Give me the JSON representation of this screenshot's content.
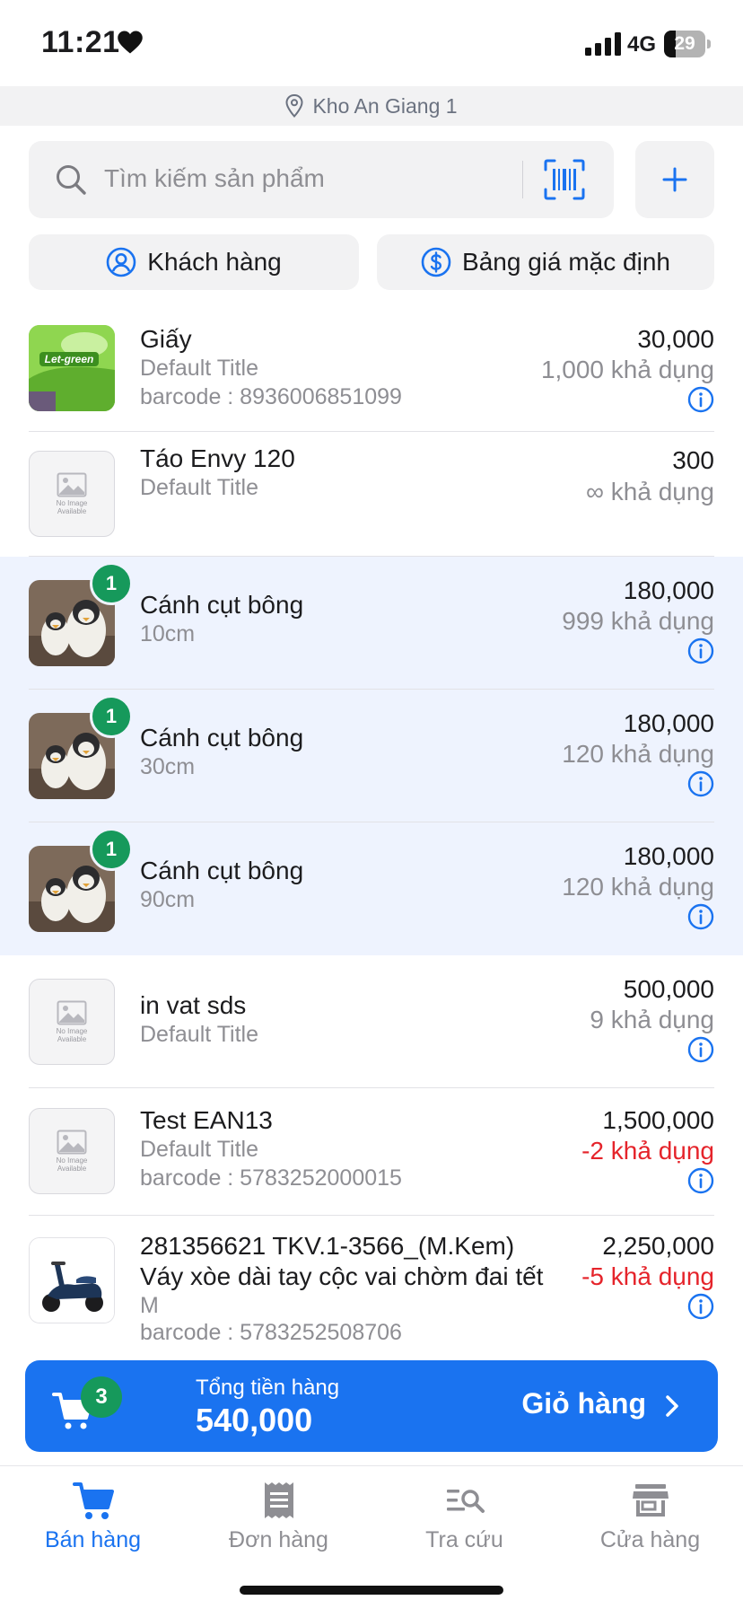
{
  "status_bar": {
    "time": "11:21",
    "network": "4G",
    "battery": "29"
  },
  "location": {
    "label": "Kho An Giang 1"
  },
  "search": {
    "placeholder": "Tìm kiếm sản phẩm"
  },
  "filters": {
    "customer_label": "Khách hàng",
    "price_list_label": "Bảng giá mặc định"
  },
  "colors": {
    "accent": "#1a73f0",
    "badge": "#16995b",
    "negative": "#e5242b",
    "selected_row": "#eef3fe"
  },
  "products": [
    {
      "name": "Giấy",
      "variant": "Default Title",
      "barcode": "barcode : 8936006851099",
      "price": "30,000",
      "stock": "1,000 khả dụng",
      "quantity": "",
      "image": "let-green-tissue"
    },
    {
      "name": "Táo Envy 120",
      "variant": "Default Title",
      "barcode": "",
      "price": "300",
      "stock": "∞ khả dụng",
      "quantity": "",
      "image": "no-image"
    },
    {
      "name": "Cánh cụt bông",
      "variant": "10cm",
      "barcode": "",
      "price": "180,000",
      "stock": "999 khả dụng",
      "quantity": "1",
      "image": "penguin-plush"
    },
    {
      "name": "Cánh cụt bông",
      "variant": "30cm",
      "barcode": "",
      "price": "180,000",
      "stock": "120 khả dụng",
      "quantity": "1",
      "image": "penguin-plush"
    },
    {
      "name": "Cánh cụt bông",
      "variant": "90cm",
      "barcode": "",
      "price": "180,000",
      "stock": "120 khả dụng",
      "quantity": "1",
      "image": "penguin-plush"
    },
    {
      "name": "in vat sds",
      "variant": "Default Title",
      "barcode": "",
      "price": "500,000",
      "stock": "9 khả dụng",
      "quantity": "",
      "image": "no-image"
    },
    {
      "name": "Test EAN13",
      "variant": "Default Title",
      "barcode": "barcode : 5783252000015",
      "price": "1,500,000",
      "stock": "-2 khả dụng",
      "quantity": "",
      "image": "no-image"
    },
    {
      "name": "281356621 TKV.1-3566_(M.Kem)",
      "name_line2": "Váy xòe dài tay cộc vai chờm đai tết",
      "variant": "M",
      "barcode": "barcode : 5783252508706",
      "price": "2,250,000",
      "stock": "-5 khả dụng",
      "quantity": "",
      "image": "scooter"
    }
  ],
  "no_image": {
    "line1": "No Image",
    "line2": "Available"
  },
  "cart": {
    "item_count": "3",
    "total_label": "Tổng tiền hàng",
    "total": "540,000",
    "cta_label": "Giỏ hàng"
  },
  "tabs": [
    {
      "label": "Bán hàng",
      "icon": "cart-icon",
      "active": true
    },
    {
      "label": "Đơn hàng",
      "icon": "receipt-icon",
      "active": false
    },
    {
      "label": "Tra cứu",
      "icon": "list-search-icon",
      "active": false
    },
    {
      "label": "Cửa hàng",
      "icon": "store-icon",
      "active": false
    }
  ]
}
